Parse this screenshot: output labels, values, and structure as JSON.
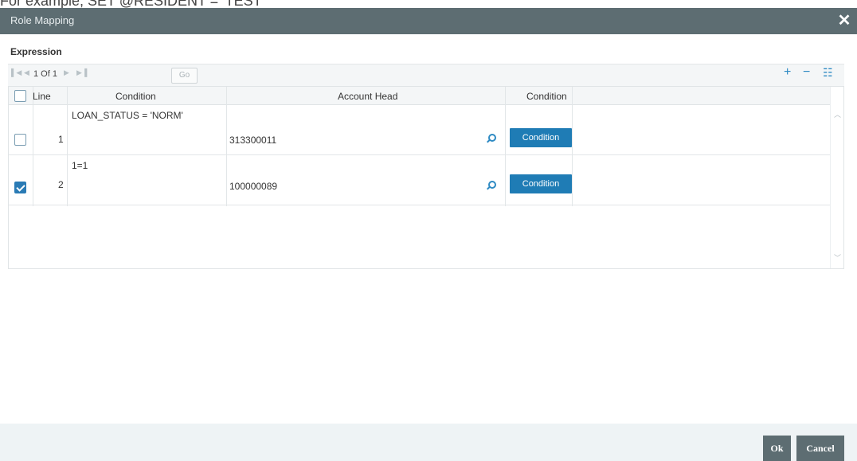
{
  "top_strip": {
    "text": "For example, SET @RESIDENT = 'TEST'"
  },
  "dialog": {
    "title": "Role Mapping",
    "close_glyph": "✕"
  },
  "section": {
    "label": "Expression"
  },
  "pager": {
    "page_info": "1 Of 1",
    "go_label": "Go"
  },
  "toolbar": {
    "add_glyph": "+",
    "remove_glyph": "−",
    "columns_glyph": "☷"
  },
  "grid": {
    "columns": [
      "Line",
      "Condition",
      "Account Head",
      "Condition"
    ],
    "rows": [
      {
        "line": "1",
        "condition": "LOAN_STATUS = 'NORM'",
        "account_head": "313300011",
        "checked": false,
        "button_label": "Condition"
      },
      {
        "line": "2",
        "condition": "1=1",
        "account_head": "100000089",
        "checked": true,
        "button_label": "Condition"
      }
    ]
  },
  "footer": {
    "ok_label": "Ok",
    "cancel_label": "Cancel"
  },
  "colors": {
    "titlebar": "#5d6d72",
    "accent": "#1f7cb5",
    "footer": "#eef3f5"
  }
}
